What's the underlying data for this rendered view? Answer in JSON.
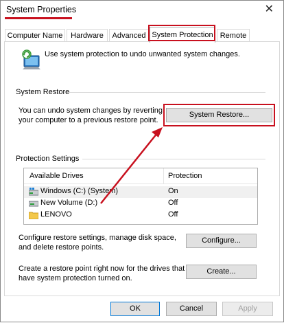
{
  "window": {
    "title": "System Properties",
    "close_glyph": "✕"
  },
  "tabs": [
    {
      "label": "Computer Name"
    },
    {
      "label": "Hardware"
    },
    {
      "label": "Advanced"
    },
    {
      "label": "System Protection",
      "active": true
    },
    {
      "label": "Remote"
    }
  ],
  "intro": "Use system protection to undo unwanted system changes.",
  "system_restore": {
    "group_title": "System Restore",
    "text_line1": "You can undo system changes by reverting",
    "text_line2": "your computer to a previous restore point.",
    "button": "System Restore..."
  },
  "protection_settings": {
    "group_title": "Protection Settings",
    "columns": [
      "Available Drives",
      "Protection"
    ],
    "rows": [
      {
        "drive": "Windows (C:) (System)",
        "protection": "On",
        "icon": "system-drive-icon"
      },
      {
        "drive": "New Volume (D:)",
        "protection": "Off",
        "icon": "drive-icon"
      },
      {
        "drive": "LENOVO",
        "protection": "Off",
        "icon": "folder-drive-icon"
      }
    ],
    "configure_line1": "Configure restore settings, manage disk space,",
    "configure_line2": "and delete restore points.",
    "configure_button": "Configure...",
    "create_line1": "Create a restore point right now for the drives that",
    "create_line2": "have system protection turned on.",
    "create_button": "Create..."
  },
  "footer": {
    "ok": "OK",
    "cancel": "Cancel",
    "apply": "Apply"
  },
  "colors": {
    "highlight": "#c8101e",
    "button_face": "#e1e1e1"
  }
}
